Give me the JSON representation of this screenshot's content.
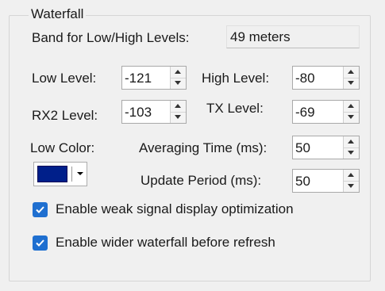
{
  "group": {
    "title": "Waterfall"
  },
  "band": {
    "label": "Band for Low/High Levels:",
    "value": "49 meters"
  },
  "low_level": {
    "label": "Low Level:",
    "value": "-121"
  },
  "high_level": {
    "label": "High Level:",
    "value": "-80"
  },
  "rx2_level": {
    "label": "RX2 Level:",
    "value": "-103"
  },
  "tx_level": {
    "label": "TX Level:",
    "value": "-69"
  },
  "low_color": {
    "label": "Low Color:",
    "swatch_color": "#001f8a"
  },
  "averaging_time": {
    "label": "Averaging Time (ms):",
    "value": "50"
  },
  "update_period": {
    "label": "Update Period (ms):",
    "value": "50"
  },
  "options": [
    {
      "label": "Enable weak signal display optimization",
      "checked": true
    },
    {
      "label": "Enable wider waterfall before refresh",
      "checked": true
    }
  ],
  "colors": {
    "checkbox": "#1f6fd0",
    "background": "#f0f0f0"
  }
}
